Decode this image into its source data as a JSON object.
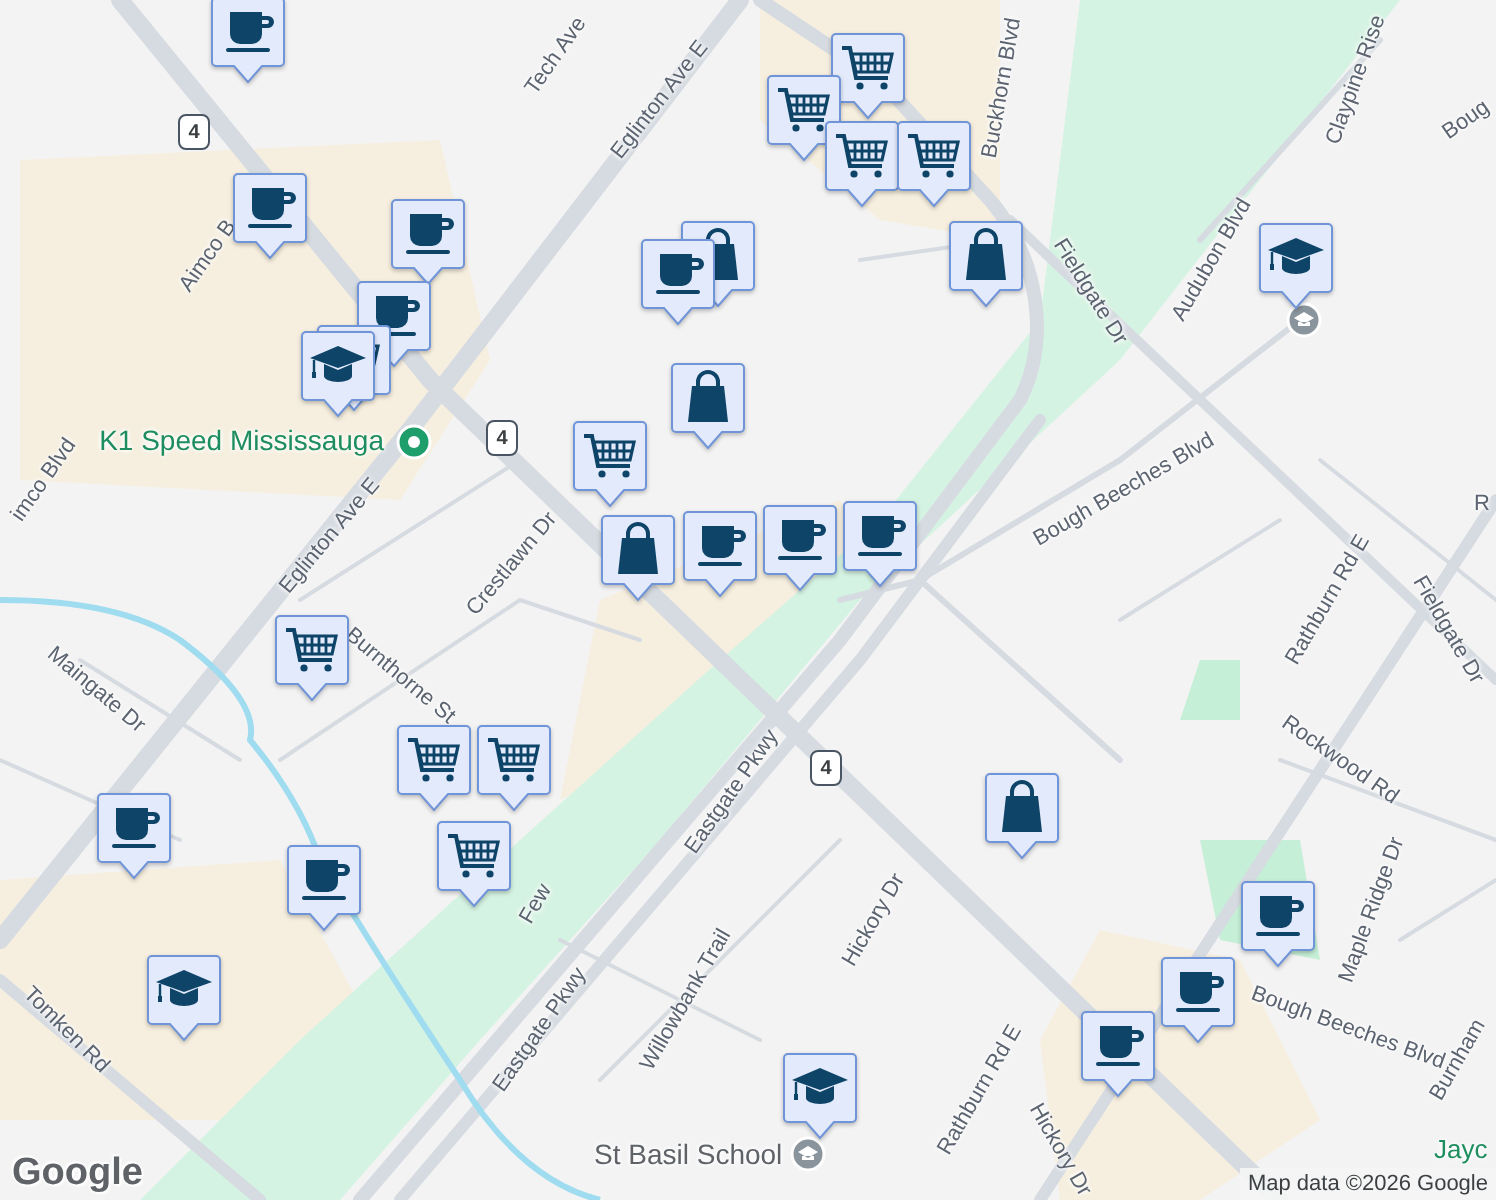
{
  "map": {
    "markers": [
      {
        "kind": "coffee"
      },
      {
        "kind": "cart"
      },
      {
        "kind": "cart"
      },
      {
        "kind": "cart"
      },
      {
        "kind": "cart"
      },
      {
        "kind": "bag"
      },
      {
        "kind": "coffee"
      },
      {
        "kind": "coffee"
      },
      {
        "kind": "bag"
      },
      {
        "kind": "coffee"
      },
      {
        "kind": "coffee"
      },
      {
        "kind": "cart"
      },
      {
        "kind": "school"
      },
      {
        "kind": "bag"
      },
      {
        "kind": "school"
      },
      {
        "kind": "cart"
      },
      {
        "kind": "coffee"
      },
      {
        "kind": "coffee"
      },
      {
        "kind": "bag"
      },
      {
        "kind": "coffee"
      },
      {
        "kind": "cart"
      },
      {
        "kind": "cart"
      },
      {
        "kind": "cart"
      },
      {
        "kind": "cart"
      },
      {
        "kind": "bag"
      },
      {
        "kind": "coffee"
      },
      {
        "kind": "coffee"
      },
      {
        "kind": "coffee"
      },
      {
        "kind": "coffee"
      },
      {
        "kind": "coffee"
      },
      {
        "kind": "school"
      },
      {
        "kind": "school"
      }
    ],
    "place_pins": [
      {
        "kind": "business"
      },
      {
        "kind": "school"
      },
      {
        "kind": "school"
      }
    ],
    "place_labels": [
      {
        "text": "K1 Speed Mississauga",
        "kind": "business"
      },
      {
        "text": "St Basil School",
        "kind": "school"
      },
      {
        "text": "Jayc",
        "kind": "business"
      }
    ],
    "road_labels": [
      "Tech Ave",
      "Eglinton Ave E",
      "Eglinton Ave E",
      "Aimco B",
      "imco Blvd",
      "Buckhorn Blvd",
      "Fieldgate Dr",
      "Audubon Blvd",
      "Claypine Rise",
      "Boug",
      "Bough Beeches Blvd",
      "Crestlawn Dr",
      "Burnthorne St",
      "Maingate Dr",
      "Few",
      "Eastgate Pkwy",
      "Eastgate Pkwy",
      "Tomken Rd",
      "Willowbank Trail",
      "Hickory Dr",
      "Hickory Dr",
      "Rathburn Rd E",
      "Rathburn Rd E",
      "Rockwood Rd",
      "Maple Ridge Dr",
      "Bough Beeches Blvd",
      "Burnham",
      "Fieldgate Dr",
      "R"
    ],
    "route_shields": [
      "4",
      "4",
      "4"
    ],
    "logo": "Google",
    "attribution": "Map data ©2026 Google"
  }
}
